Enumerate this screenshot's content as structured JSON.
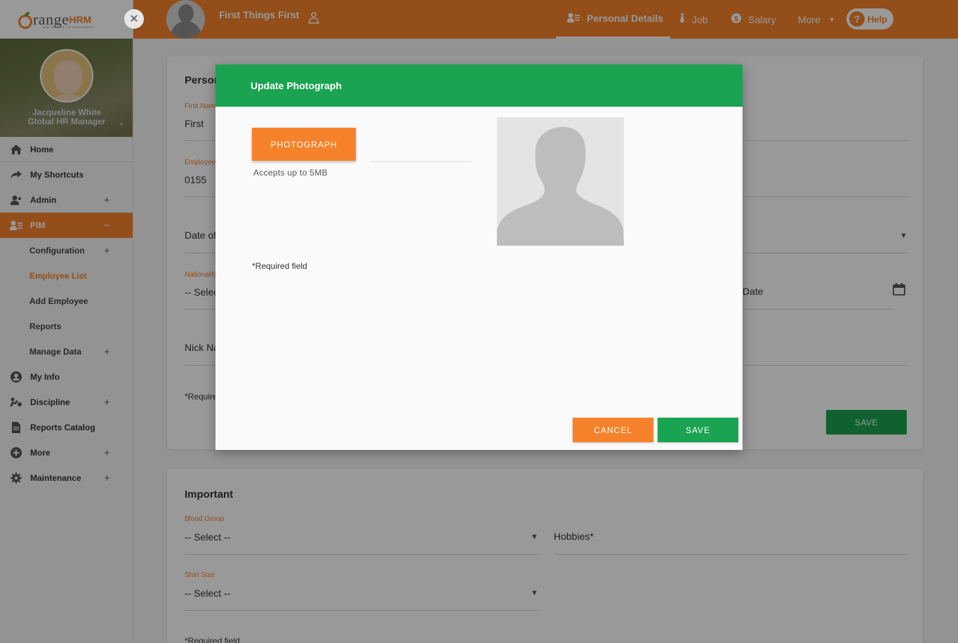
{
  "brand": {
    "logo_main": "range",
    "logo_hrm": "HRM",
    "logo_tagline": "NEW LEVEL OF HR MANAGEMENT",
    "accent": "#f5822a",
    "green": "#1aa350"
  },
  "user": {
    "name": "Jacqueline White",
    "role": "Global HR Manager"
  },
  "sidebar": {
    "items": [
      {
        "label": "Home",
        "icon": "home-icon"
      },
      {
        "label": "My Shortcuts",
        "icon": "share-icon"
      },
      {
        "label": "Admin",
        "icon": "admin-user-icon",
        "expander": "+"
      },
      {
        "label": "PIM",
        "icon": "pim-icon",
        "expander": "−"
      },
      {
        "label": "My Info",
        "icon": "person-circle-icon"
      },
      {
        "label": "Discipline",
        "icon": "discipline-icon",
        "expander": "+"
      },
      {
        "label": "Reports Catalog",
        "icon": "document-icon"
      },
      {
        "label": "More",
        "icon": "plus-circle-icon",
        "expander": "+"
      },
      {
        "label": "Maintenance",
        "icon": "gear-icon",
        "expander": "+"
      }
    ],
    "pim_subitems": [
      {
        "label": "Configuration",
        "expander": "+"
      },
      {
        "label": "Employee List"
      },
      {
        "label": "Add Employee"
      },
      {
        "label": "Reports"
      },
      {
        "label": "Manage Data",
        "expander": "+"
      }
    ]
  },
  "topbar": {
    "employee_name": "First Things First",
    "tabs": [
      {
        "label": "Personal Details",
        "icon": "id-card-icon"
      },
      {
        "label": "Job",
        "icon": "tie-icon"
      },
      {
        "label": "Salary",
        "icon": "dollar-icon"
      },
      {
        "label": "More",
        "icon": "caret-down-icon"
      }
    ],
    "help_label": "Help"
  },
  "personal": {
    "title": "Person",
    "first_name_label": "First Nam",
    "first_name_value": "First",
    "employee_id_label": "Employee",
    "employee_id_value": "0155",
    "dob_label": "Date of",
    "nationality_label": "Nationality",
    "nationality_value": "-- Selec",
    "date_value": "Date",
    "nick_name_label": "Nick Na",
    "required_note": "*Require",
    "save_label": "SAVE"
  },
  "important": {
    "title": "Important",
    "blood_group_label": "Blood Group",
    "blood_group_value": "-- Select --",
    "hobbies_label": "Hobbies*",
    "shirt_size_label": "Shirt Size",
    "shirt_size_value": "-- Select --",
    "required_note": "*Required field"
  },
  "modal": {
    "title": "Update Photograph",
    "photo_button": "PHOTOGRAPH",
    "accepts_note": "Accepts up to 5MB",
    "required_note": "*Required field",
    "cancel_label": "CANCEL",
    "save_label": "SAVE"
  }
}
